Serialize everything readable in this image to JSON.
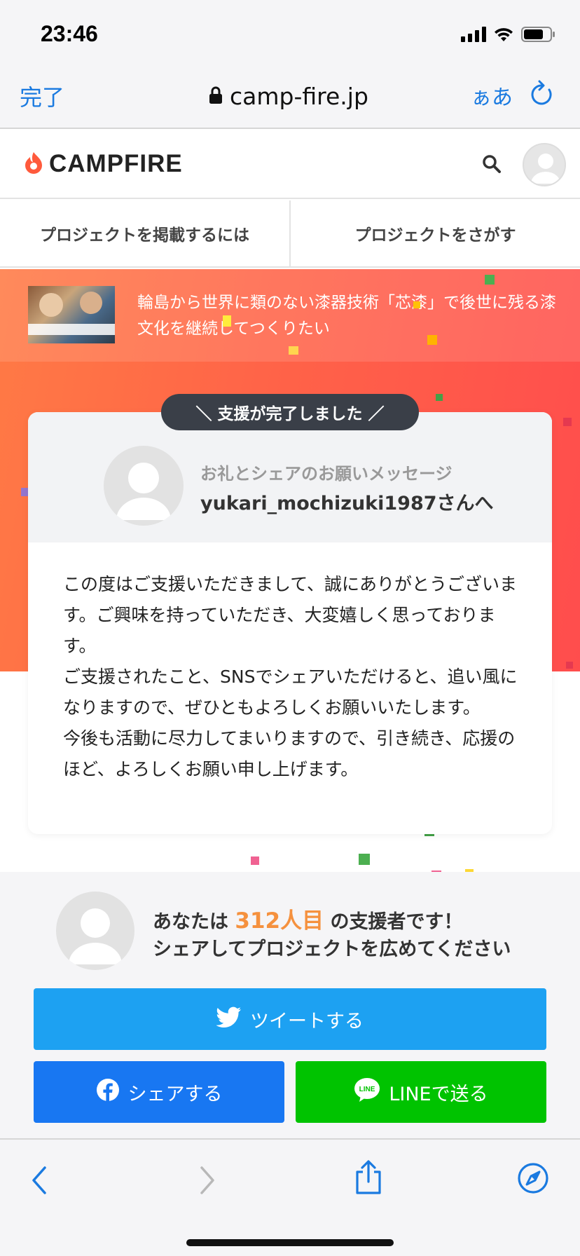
{
  "status_bar": {
    "time": "23:46"
  },
  "browser": {
    "done_label": "完了",
    "url": "camp-fire.jp",
    "text_size_label": "ぁあ"
  },
  "site": {
    "logo_text": "CAMPFIRE",
    "brand_color": "#ff5a3c"
  },
  "nav": {
    "items": [
      {
        "label": "プロジェクトを掲載するには"
      },
      {
        "label": "プロジェクトをさがす"
      }
    ]
  },
  "project": {
    "title": "輪島から世界に類のない漆器技術「芯漆」で後世に残る漆文化を継続してつくりたい"
  },
  "thanks_card": {
    "badge": "＼ 支援が完了しました ／",
    "subtitle": "お礼とシェアのお願いメッセージ",
    "recipient": "yukari_mochizuki1987さんへ",
    "message": "この度はご支援いただきまして、誠にありがとうございます。ご興味を持っていただき、大変嬉しく思っております。\nご支援されたこと、SNSでシェアいただけると、追い風になりますので、ぜひともよろしくお願いいたします。\n今後も活動に尽力してまいりますので、引き続き、応援のほど、よろしくお願い申し上げます。"
  },
  "share": {
    "prefix": "あなたは",
    "count": "312人目",
    "suffix": "の支援者です！",
    "line2": "シェアしてプロジェクトを広めてください",
    "tweet_label": "ツイートする",
    "facebook_label": "シェアする",
    "line_label": "LINEで送る",
    "colors": {
      "twitter": "#1da1f2",
      "facebook": "#1877f2",
      "line": "#00c300",
      "count": "#f5913e"
    }
  }
}
